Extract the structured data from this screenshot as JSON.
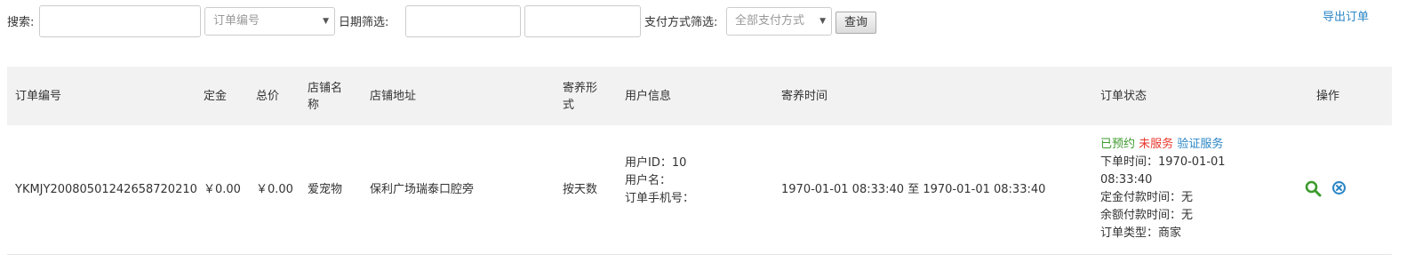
{
  "filters": {
    "search_label": "搜索:",
    "search_value": "",
    "order_field_select": "订单编号",
    "date_label": "日期筛选:",
    "date_start_value": "",
    "date_end_value": "",
    "payment_label": "支付方式筛选:",
    "payment_select": "全部支付方式",
    "query_button": "查询",
    "export_link": "导出订单"
  },
  "table": {
    "headers": {
      "order_no": "订单编号",
      "deposit": "定金",
      "total": "总价",
      "store_name": "店铺名称",
      "store_address": "店铺地址",
      "boarding_type": "寄养形式",
      "user_info": "用户信息",
      "boarding_time": "寄养时间",
      "order_status": "订单状态",
      "actions": "操作"
    },
    "rows": [
      {
        "order_no": "YKMJY20080501242658720210",
        "deposit": "￥0.00",
        "total": "￥0.00",
        "store_name": "爱宠物",
        "store_address": "保利广场瑞泰口腔旁",
        "boarding_type": "按天数",
        "user_id": "用户ID：10",
        "user_name": "用户名：",
        "user_phone": "订单手机号：",
        "boarding_time": "1970-01-01 08:33:40 至 1970-01-01 08:33:40",
        "status_reserved": "已预约",
        "status_unserved": "未服务",
        "verify_link": "验证服务",
        "order_time_label": "下单时间：1970-01-01",
        "order_time_rest": "08:33:40",
        "deposit_pay_time": "定金付款时间：无",
        "balance_pay_time": "余额付款时间：无",
        "order_type": "订单类型：商家"
      }
    ]
  },
  "colors": {
    "link_blue": "#2b86c5",
    "status_green": "#3c9a2c",
    "status_red": "#e8372c",
    "header_bg": "#f2f2f2"
  },
  "icons": {
    "view": "search-icon",
    "cancel": "close-circle-icon",
    "select_caret": "caret-down-icon"
  }
}
